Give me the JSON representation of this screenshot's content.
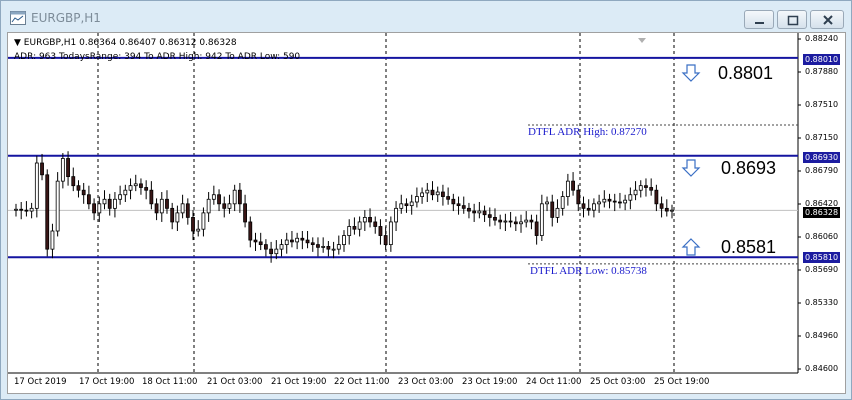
{
  "window": {
    "title": "EURGBP,H1",
    "minimize": "minimize",
    "maximize": "maximize",
    "close": "close"
  },
  "header": {
    "symbol_line": "EURGBP,H1  0.86364 0.86407 0.86312 0.86328",
    "adr_line": "ADR: 963  TodaysRange: 394   To ADR High: 942   To ADR Low: 590"
  },
  "levels": {
    "high_label": "0.8801",
    "mid_label": "0.8693",
    "low_label": "0.8581",
    "dtfl_high": "DTFL ADR High: 0.87270",
    "dtfl_low": "DTFL ADR Low: 0.85738"
  },
  "price_axis": {
    "ticks": [
      "0.88240",
      "0.87880",
      "0.87510",
      "0.87150",
      "0.86790",
      "0.86420",
      "0.86060",
      "0.85690",
      "0.85330",
      "0.84960",
      "0.84600"
    ],
    "box_high": "0.88010",
    "box_mid": "0.86930",
    "box_current": "0.86328",
    "box_low": "0.85810"
  },
  "time_axis": {
    "ticks": [
      "17 Oct 2019",
      "17 Oct 19:00",
      "18 Oct 11:00",
      "21 Oct 03:00",
      "21 Oct 19:00",
      "22 Oct 11:00",
      "23 Oct 03:00",
      "23 Oct 19:00",
      "24 Oct 11:00",
      "25 Oct 03:00",
      "25 Oct 19:00"
    ]
  },
  "chart_data": {
    "type": "candlestick",
    "symbol": "EURGBP",
    "timeframe": "H1",
    "ylim": [
      0.846,
      0.8824
    ],
    "horizontal_lines": [
      0.8801,
      0.8693,
      0.8581
    ],
    "dotted_levels": [
      0.8727,
      0.85738
    ],
    "current_price": 0.86328,
    "close_series": [
      0.8634,
      0.8633,
      0.8632,
      0.8635,
      0.8685,
      0.8672,
      0.859,
      0.861,
      0.8665,
      0.869,
      0.867,
      0.866,
      0.8655,
      0.865,
      0.864,
      0.863,
      0.864,
      0.8645,
      0.8635,
      0.8645,
      0.865,
      0.8655,
      0.866,
      0.8662,
      0.8658,
      0.8655,
      0.864,
      0.863,
      0.8645,
      0.8635,
      0.862,
      0.863,
      0.864,
      0.8625,
      0.861,
      0.8612,
      0.863,
      0.8645,
      0.865,
      0.864,
      0.8635,
      0.864,
      0.8655,
      0.864,
      0.862,
      0.86,
      0.8598,
      0.8595,
      0.859,
      0.8585,
      0.859,
      0.8595,
      0.86,
      0.8598,
      0.8602,
      0.86,
      0.8597,
      0.8595,
      0.8592,
      0.8593,
      0.859,
      0.859,
      0.8595,
      0.8605,
      0.8615,
      0.8612,
      0.862,
      0.8625,
      0.862,
      0.8615,
      0.8605,
      0.8595,
      0.862,
      0.8635,
      0.864,
      0.8638,
      0.8642,
      0.8648,
      0.8652,
      0.8655,
      0.865,
      0.8653,
      0.8648,
      0.8645,
      0.864,
      0.8638,
      0.8635,
      0.8632,
      0.863,
      0.8632,
      0.8628,
      0.8625,
      0.8622,
      0.862,
      0.8621,
      0.862,
      0.8618,
      0.862,
      0.8622,
      0.862,
      0.8605,
      0.864,
      0.8642,
      0.8625,
      0.8635,
      0.8648,
      0.8665,
      0.8655,
      0.864,
      0.8635,
      0.8633,
      0.864,
      0.8642,
      0.8645,
      0.8643,
      0.8642,
      0.8641,
      0.8644,
      0.865,
      0.8655,
      0.866,
      0.8658,
      0.8655,
      0.864,
      0.8635,
      0.8632,
      0.8633
    ]
  }
}
